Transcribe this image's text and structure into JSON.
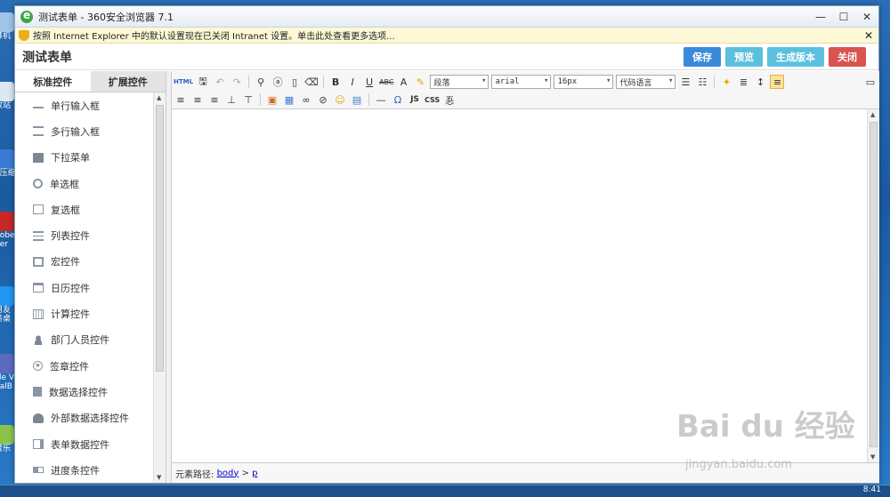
{
  "desktop": {
    "icons": [
      "算机",
      "收站",
      "0压缩",
      "dobe\nder",
      "用友\n务桌",
      "cle V\nualB",
      "音乐"
    ]
  },
  "window": {
    "title": "测试表单 - 360安全浏览器 7.1"
  },
  "infobar": {
    "text": "按照 Internet Explorer 中的默认设置现在已关闭 Intranet 设置。单击此处查看更多选项..."
  },
  "page": {
    "title": "测试表单",
    "buttons": [
      {
        "label": "保存",
        "color": "#3b8ad9"
      },
      {
        "label": "预览",
        "color": "#5bc0de"
      },
      {
        "label": "生成版本",
        "color": "#5bc0de"
      },
      {
        "label": "关闭",
        "color": "#d9534f"
      }
    ]
  },
  "left_panel": {
    "tabs": [
      "标准控件",
      "扩展控件"
    ],
    "items": [
      {
        "label": "单行输入框",
        "icon": "text-input-icon"
      },
      {
        "label": "多行输入框",
        "icon": "textarea-icon"
      },
      {
        "label": "下拉菜单",
        "icon": "dropdown-icon"
      },
      {
        "label": "单选框",
        "icon": "radio-icon"
      },
      {
        "label": "复选框",
        "icon": "checkbox-icon"
      },
      {
        "label": "列表控件",
        "icon": "list-icon"
      },
      {
        "label": "宏控件",
        "icon": "macro-icon"
      },
      {
        "label": "日历控件",
        "icon": "calendar-icon"
      },
      {
        "label": "计算控件",
        "icon": "calculator-icon"
      },
      {
        "label": "部门人员控件",
        "icon": "user-icon"
      },
      {
        "label": "签章控件",
        "icon": "seal-icon"
      },
      {
        "label": "数据选择控件",
        "icon": "data-select-icon"
      },
      {
        "label": "外部数据选择控件",
        "icon": "cloud-icon"
      },
      {
        "label": "表单数据控件",
        "icon": "form-data-icon"
      },
      {
        "label": "进度条控件",
        "icon": "progress-icon"
      }
    ]
  },
  "editor": {
    "toolbar": {
      "html_label": "HTML",
      "bold": "B",
      "italic": "I",
      "underline": "U",
      "strike": "ABC",
      "font_color": "A",
      "paragraph": "段落",
      "font_family": "arial",
      "font_size": "16px",
      "code_lang": "代码语言",
      "hr": "—",
      "omega": "Ω",
      "js": "JS",
      "css": "CSS",
      "chinese": "忢"
    },
    "status": {
      "label": "元素路径:",
      "path1": "body",
      "separator": ">",
      "path2": "p"
    }
  },
  "taskbar": {
    "clock": "8:41"
  },
  "watermark": {
    "text": "Bai du 经验",
    "sub": "jingyan.baidu.com"
  }
}
